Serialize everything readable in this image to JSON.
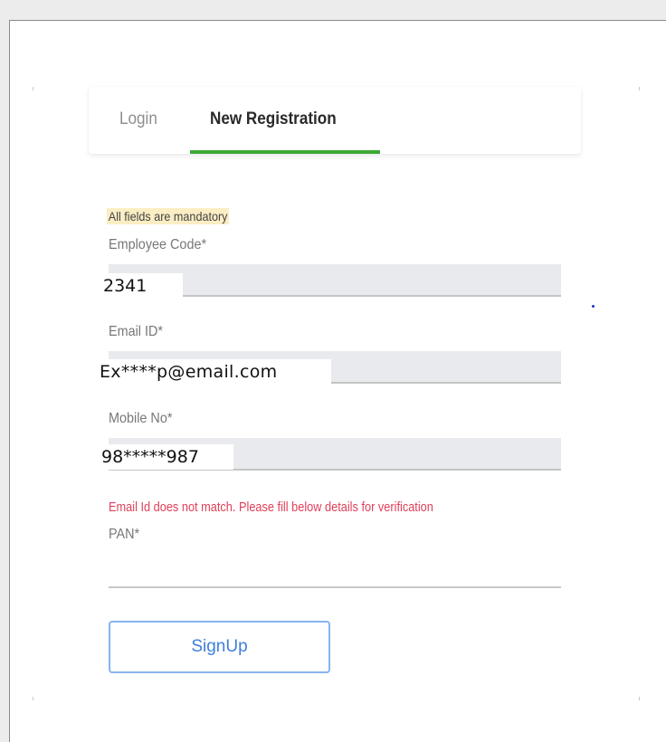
{
  "tabs": [
    {
      "label": "Login"
    },
    {
      "label": "New Registration"
    }
  ],
  "form": {
    "notice": "All fields are mandatory",
    "employee_code": {
      "label": "Employee Code*",
      "value": "2341"
    },
    "email": {
      "label": "Email ID*",
      "value": "Ex****p@email.com"
    },
    "mobile": {
      "label": "Mobile No*",
      "value": "98*****987"
    },
    "error": "Email Id does not match. Please fill below details for verification",
    "pan": {
      "label": "PAN*",
      "value": ""
    },
    "signup_label": "SignUp"
  },
  "colors": {
    "tab_active_underline": "#3aaa35",
    "error_text": "#e0405a",
    "button_border": "#87b4ef",
    "button_text": "#3d7fdb",
    "notice_highlight": "#fbeec4"
  }
}
